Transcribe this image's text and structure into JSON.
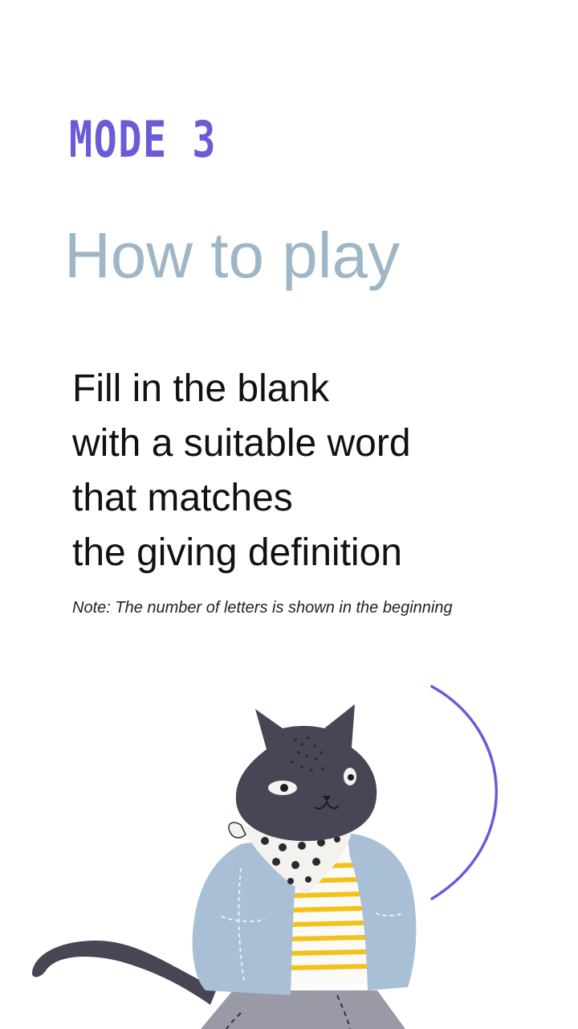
{
  "header": {
    "mode_label": "MODE 3",
    "title": "How to play"
  },
  "instructions": {
    "lines": [
      "Fill in the blank",
      "with a suitable word",
      "that matches",
      "the giving definition"
    ],
    "note": "Note: The number of letters is shown in the beginning"
  },
  "illustration": {
    "subject": "cat-in-denim-jacket",
    "colors": {
      "accent_arc": "#6a5bd6",
      "cat_fur": "#4a4555",
      "jacket": "#a9bfd6",
      "shirt_stripes": "#f2c21b",
      "pants": "#9a9aa6"
    }
  },
  "theme": {
    "mode_color": "#6a5bd6",
    "title_color": "#9fb6c6",
    "text_color": "#111111"
  }
}
